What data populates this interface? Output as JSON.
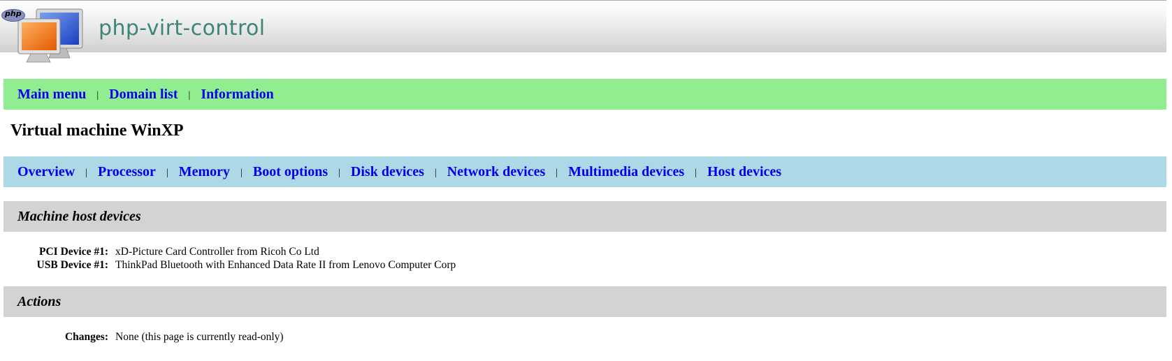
{
  "app": {
    "title": "php-virt-control",
    "logo_badge": "php"
  },
  "main_nav": {
    "items": [
      {
        "label": "Main menu"
      },
      {
        "label": "Domain list"
      },
      {
        "label": "Information"
      }
    ],
    "separator": "|"
  },
  "page": {
    "title": "Virtual machine WinXP"
  },
  "sub_nav": {
    "items": [
      {
        "label": "Overview"
      },
      {
        "label": "Processor"
      },
      {
        "label": "Memory"
      },
      {
        "label": "Boot options"
      },
      {
        "label": "Disk devices"
      },
      {
        "label": "Network devices"
      },
      {
        "label": "Multimedia devices"
      },
      {
        "label": "Host devices"
      }
    ],
    "separator": "|"
  },
  "host_devices": {
    "heading": "Machine host devices",
    "rows": [
      {
        "label": "PCI Device #1:",
        "value": "xD-Picture Card Controller from Ricoh Co Ltd"
      },
      {
        "label": "USB Device #1:",
        "value": "ThinkPad Bluetooth with Enhanced Data Rate II from Lenovo Computer Corp"
      }
    ]
  },
  "actions": {
    "heading": "Actions",
    "rows": [
      {
        "label": "Changes:",
        "value": "None (this page is currently read-only)"
      }
    ]
  },
  "colors": {
    "main_nav_bg": "#90ee90",
    "sub_nav_bg": "#add8e6",
    "section_bg": "#d3d3d3",
    "link": "#0000ee",
    "title_text": "#3d8577"
  }
}
